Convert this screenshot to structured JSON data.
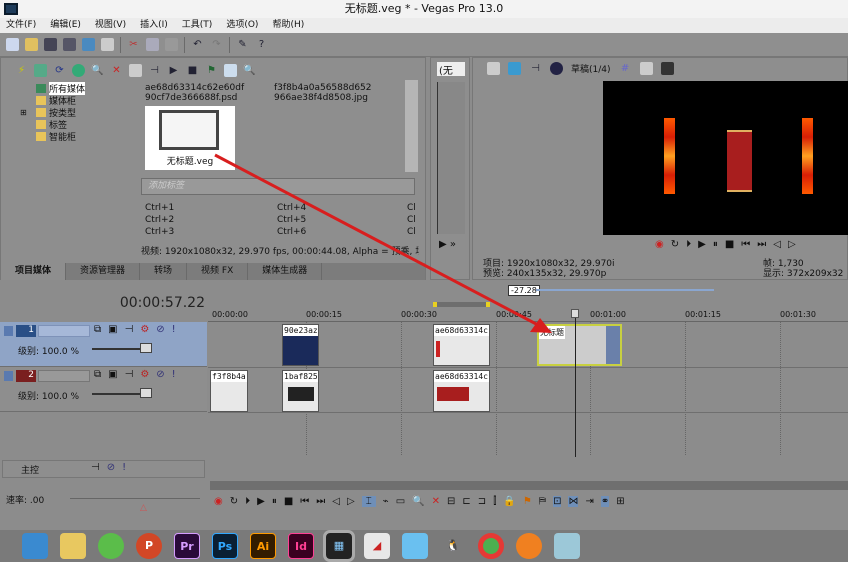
{
  "window": {
    "title": "无标题.veg * - Vegas Pro 13.0"
  },
  "menu": [
    "文件(F)",
    "编辑(E)",
    "视图(V)",
    "插入(I)",
    "工具(T)",
    "选项(O)",
    "帮助(H)"
  ],
  "media": {
    "tree": [
      "所有媒体",
      "媒体柜",
      "按类型",
      "标签",
      "智能柜"
    ],
    "files": [
      "ae68d63314c62e60df",
      "f3f8b4a0a56588d652",
      "90cf7de366688f.psd",
      "966ae38f4d8508.jpg"
    ],
    "selected_file": "无标题.veg",
    "tag_placeholder": "添加标签",
    "shortcuts": [
      "Ctrl+1",
      "Ctrl+4",
      "Cl",
      "Ctrl+2",
      "Ctrl+5",
      "Cl",
      "Ctrl+3",
      "Ctrl+6",
      "Cl"
    ],
    "info": "视频: 1920x1080x32, 29.970 fps, 00:00:44.08, Alpha = 预乘, 场顺序",
    "tabs": [
      "项目媒体",
      "资源管理器",
      "转场",
      "视频 FX",
      "媒体生成器"
    ]
  },
  "narrow": {
    "dropdown": "(无"
  },
  "preview": {
    "quality": "草稿(1/4)",
    "project": "项目: 1920x1080x32, 29.970i",
    "preview": "预览: 240x135x32, 29.970p",
    "frame": "帧:    1,730",
    "display": "显示: 372x209x32"
  },
  "timeline": {
    "time": "00:00:57.22",
    "marker": "-27.28",
    "ruler": [
      "00:00:00",
      "00:00:15",
      "00:00:30",
      "00:00:45",
      "00:01:00",
      "00:01:15",
      "00:01:30"
    ],
    "tracks": [
      {
        "num": "1",
        "level": "级别: 100.0 %",
        "color": "#2a4f86"
      },
      {
        "num": "2",
        "level": "级别: 100.0 %",
        "color": "#7a1f1f"
      }
    ],
    "clips1": [
      "90e23az",
      "ae68d63314c",
      "无标题"
    ],
    "clips2": [
      "f3f8b4a",
      "1baf825",
      "ae68d63314c"
    ],
    "master": "主控",
    "rate": "速率: .00"
  },
  "accent": "#d81e1e"
}
